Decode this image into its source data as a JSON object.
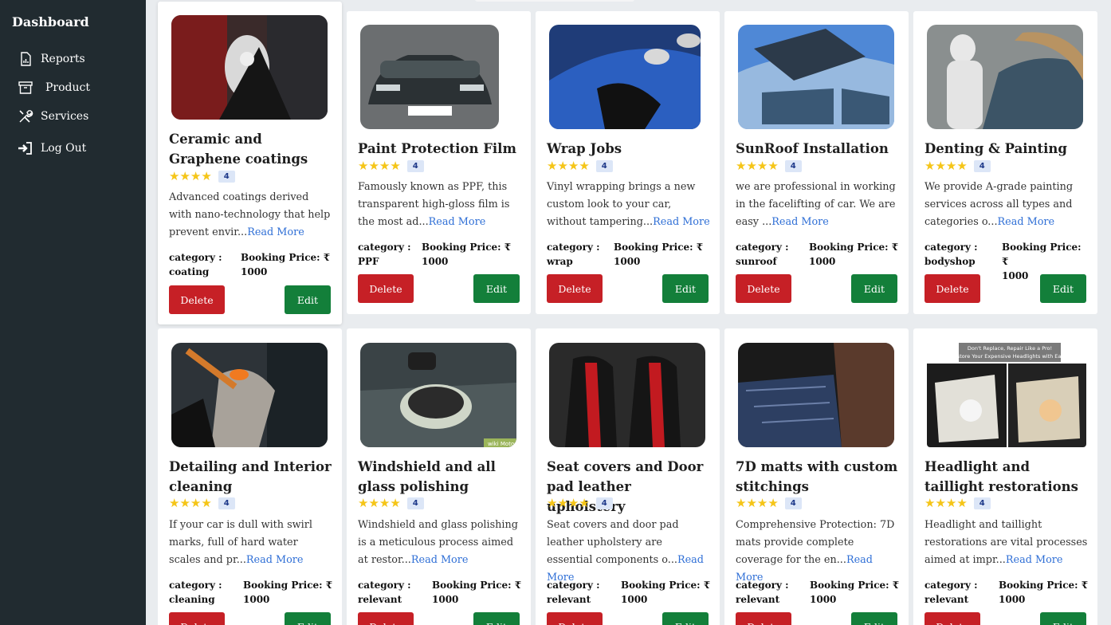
{
  "sidebar": {
    "title": "Dashboard",
    "items": [
      {
        "label": "Reports",
        "icon": "reports-icon"
      },
      {
        "label": "Product",
        "icon": "archive-icon"
      },
      {
        "label": "Services",
        "icon": "tools-icon"
      },
      {
        "label": "Log Out",
        "icon": "logout-icon"
      }
    ]
  },
  "labels": {
    "category": "category :",
    "price": "Booking Price: ₹",
    "delete": "Delete",
    "edit": "Edit",
    "read_more": "Read More"
  },
  "services": [
    {
      "title": "Ceramic and Graphene coatings",
      "rating": "4",
      "desc": "Advanced coatings derived with nano-technology that help prevent envir...",
      "category": "coating",
      "price": "1000",
      "image": "person-coating-car-image"
    },
    {
      "title": "Paint Protection Film",
      "rating": "4",
      "desc": "Famously known as PPF, this transparent high-gloss film is the most ad...",
      "category": "PPF",
      "price": "1000",
      "image": "sports-car-image"
    },
    {
      "title": "Wrap Jobs",
      "rating": "4",
      "desc": "Vinyl wrapping brings a new custom look to your car, without tampering...",
      "category": "wrap",
      "price": "1000",
      "image": "blue-wrap-image"
    },
    {
      "title": "SunRoof Installation",
      "rating": "4",
      "desc": "we are professional in working in the facelifting of car. We are easy ...",
      "category": "sunroof",
      "price": "1000",
      "image": "sunroof-car-image"
    },
    {
      "title": "Denting & Painting",
      "rating": "4",
      "desc": "We provide A-grade painting services across all types and categories o...",
      "category": "bodyshop",
      "price": "1000",
      "image": "spray-painting-image"
    },
    {
      "title": "Detailing and Interior cleaning",
      "rating": "4",
      "desc": "If your car is dull with swirl marks, full of hard water scales and pr...",
      "category": "cleaning",
      "price": "1000",
      "image": "interior-cleaning-image"
    },
    {
      "title": "Windshield and all glass polishing",
      "rating": "4",
      "desc": "Windshield and glass polishing is a meticulous process aimed at restor...",
      "category": "relevant",
      "price": "1000",
      "image": "glass-polishing-image",
      "watermark": "wiki Motor"
    },
    {
      "title": "Seat covers and Door pad leather upholstery",
      "rating": "4",
      "desc": "Seat covers and door pad leather upholstery are essential components o...",
      "category": "relevant",
      "price": "1000",
      "image": "seat-covers-image"
    },
    {
      "title": "7D matts with custom stitchings",
      "rating": "4",
      "desc": "Comprehensive Protection: 7D mats provide complete coverage for the en...",
      "category": "relevant",
      "price": "1000",
      "image": "floor-mats-image"
    },
    {
      "title": "Headlight and taillight restorations",
      "rating": "4",
      "desc": "Headlight and taillight restorations are vital processes aimed at impr...",
      "category": "relevant",
      "price": "1000",
      "image": "headlight-image",
      "banner_line1": "Don't Replace, Repair Like a Pro!",
      "banner_line2": "Restore Your Expensive Headlights with Ease!"
    }
  ],
  "colors": {
    "sidebar": "#212b30",
    "delete": "#c62026",
    "edit": "#137f3a",
    "link": "#2f6fd6",
    "star": "#f5c518"
  }
}
